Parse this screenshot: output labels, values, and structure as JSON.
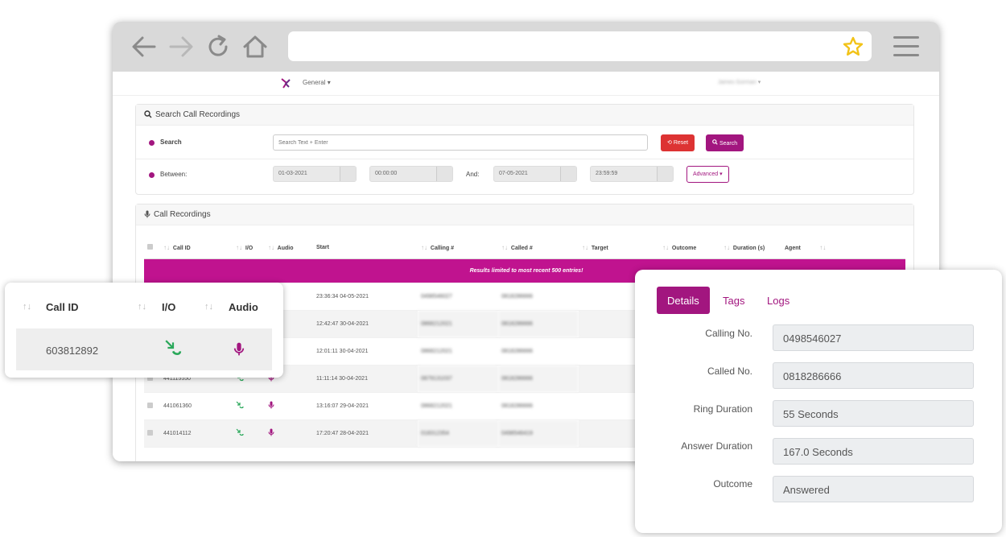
{
  "browser": {
    "nav": [
      "back-icon",
      "forward-icon",
      "reload-icon",
      "home-icon"
    ],
    "bookmark_icon": "star-icon",
    "menu_icon": "hamburger-icon"
  },
  "app": {
    "workspace": "General",
    "user": "James Gorman",
    "search_panel": {
      "title": "Search Call Recordings",
      "search_label": "Search",
      "search_placeholder": "Search Text + Enter",
      "reset_label": "Reset",
      "search_button": "Search",
      "between_label": "Between:",
      "from_date": "01-03-2021",
      "from_time": "00:00:00",
      "and_label": "And:",
      "to_date": "07-05-2021",
      "to_time": "23:59:59",
      "advanced_label": "Advanced"
    },
    "recordings_panel": {
      "title": "Call Recordings",
      "columns": [
        "Call ID",
        "I/O",
        "Audio",
        "Start",
        "Calling #",
        "Called #",
        "Target",
        "Outcome",
        "Duration (s)",
        "Agent"
      ],
      "banner": "Results limited to most recent 500 entries!",
      "rows": [
        {
          "call_id": "603812892",
          "start": "23:36:34 04-05-2021",
          "calling": "0498546027",
          "called": "0818286666"
        },
        {
          "call_id": "",
          "start": "12:42:47 30-04-2021",
          "calling": "0868212021",
          "called": "0818286666"
        },
        {
          "call_id": "",
          "start": "12:01:11 30-04-2021",
          "calling": "0868212021",
          "called": "0818286666"
        },
        {
          "call_id": "441115550",
          "start": "11:11:14 30-04-2021",
          "calling": "0879131037",
          "called": "0818286666"
        },
        {
          "call_id": "441061360",
          "start": "13:16:07 29-04-2021",
          "calling": "0868212021",
          "called": "0818286666"
        },
        {
          "call_id": "441014112",
          "start": "17:20:47 28-04-2021",
          "calling": "018312354",
          "called": "0498546419"
        }
      ]
    }
  },
  "left_card": {
    "headers": [
      "Call ID",
      "I/O",
      "Audio"
    ],
    "call_id": "603812892"
  },
  "details_card": {
    "tabs": [
      "Details",
      "Tags",
      "Logs"
    ],
    "fields": [
      {
        "label": "Calling No.",
        "value": "0498546027"
      },
      {
        "label": "Called No.",
        "value": "0818286666"
      },
      {
        "label": "Ring Duration",
        "value": "55 Seconds"
      },
      {
        "label": "Answer Duration",
        "value": "167.0 Seconds"
      },
      {
        "label": "Outcome",
        "value": "Answered"
      }
    ]
  },
  "colors": {
    "accent": "#a2167f",
    "banner": "#c0138f",
    "reset": "#dd3333",
    "inbound_icon": "#2aa85a",
    "star": "#f2c318"
  }
}
